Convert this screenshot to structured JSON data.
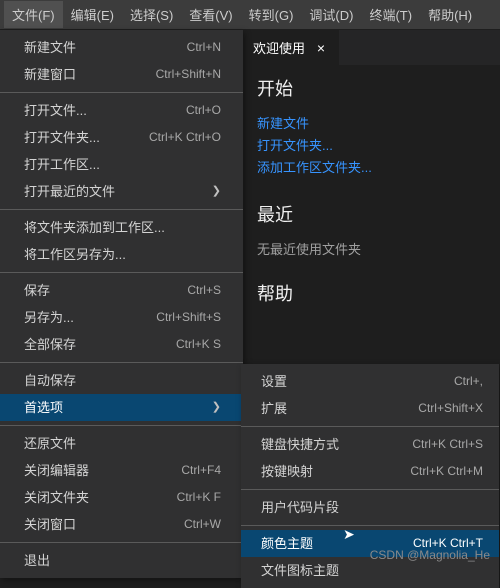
{
  "menubar": [
    "文件(F)",
    "编辑(E)",
    "选择(S)",
    "查看(V)",
    "转到(G)",
    "调试(D)",
    "终端(T)",
    "帮助(H)"
  ],
  "tab": {
    "label": "欢迎使用",
    "close": "×"
  },
  "welcome": {
    "start_title": "开始",
    "start_links": [
      "新建文件",
      "打开文件夹...",
      "添加工作区文件夹..."
    ],
    "recent_title": "最近",
    "recent_empty": "无最近使用文件夹",
    "help_title": "帮助"
  },
  "file_menu": {
    "g1": [
      {
        "label": "新建文件",
        "key": "Ctrl+N"
      },
      {
        "label": "新建窗口",
        "key": "Ctrl+Shift+N"
      }
    ],
    "g2": [
      {
        "label": "打开文件...",
        "key": "Ctrl+O"
      },
      {
        "label": "打开文件夹...",
        "key": "Ctrl+K Ctrl+O"
      },
      {
        "label": "打开工作区...",
        "key": ""
      },
      {
        "label": "打开最近的文件",
        "key": "",
        "sub": true
      }
    ],
    "g3": [
      {
        "label": "将文件夹添加到工作区...",
        "key": ""
      },
      {
        "label": "将工作区另存为...",
        "key": ""
      }
    ],
    "g4": [
      {
        "label": "保存",
        "key": "Ctrl+S"
      },
      {
        "label": "另存为...",
        "key": "Ctrl+Shift+S"
      },
      {
        "label": "全部保存",
        "key": "Ctrl+K S"
      }
    ],
    "g5": [
      {
        "label": "自动保存",
        "key": ""
      },
      {
        "label": "首选项",
        "key": "",
        "sub": true,
        "hl": true
      }
    ],
    "g6": [
      {
        "label": "还原文件",
        "key": ""
      },
      {
        "label": "关闭编辑器",
        "key": "Ctrl+F4"
      },
      {
        "label": "关闭文件夹",
        "key": "Ctrl+K F"
      },
      {
        "label": "关闭窗口",
        "key": "Ctrl+W"
      }
    ],
    "g7": [
      {
        "label": "退出",
        "key": ""
      }
    ]
  },
  "submenu": {
    "s1": [
      {
        "label": "设置",
        "key": "Ctrl+,"
      },
      {
        "label": "扩展",
        "key": "Ctrl+Shift+X"
      }
    ],
    "s2": [
      {
        "label": "键盘快捷方式",
        "key": "Ctrl+K Ctrl+S"
      },
      {
        "label": "按键映射",
        "key": "Ctrl+K Ctrl+M"
      }
    ],
    "s3": [
      {
        "label": "用户代码片段",
        "key": ""
      }
    ],
    "s4": [
      {
        "label": "颜色主题",
        "key": "Ctrl+K Ctrl+T",
        "hl": true
      },
      {
        "label": "文件图标主题",
        "key": ""
      }
    ]
  },
  "watermark": "CSDN @Magnolia_He"
}
